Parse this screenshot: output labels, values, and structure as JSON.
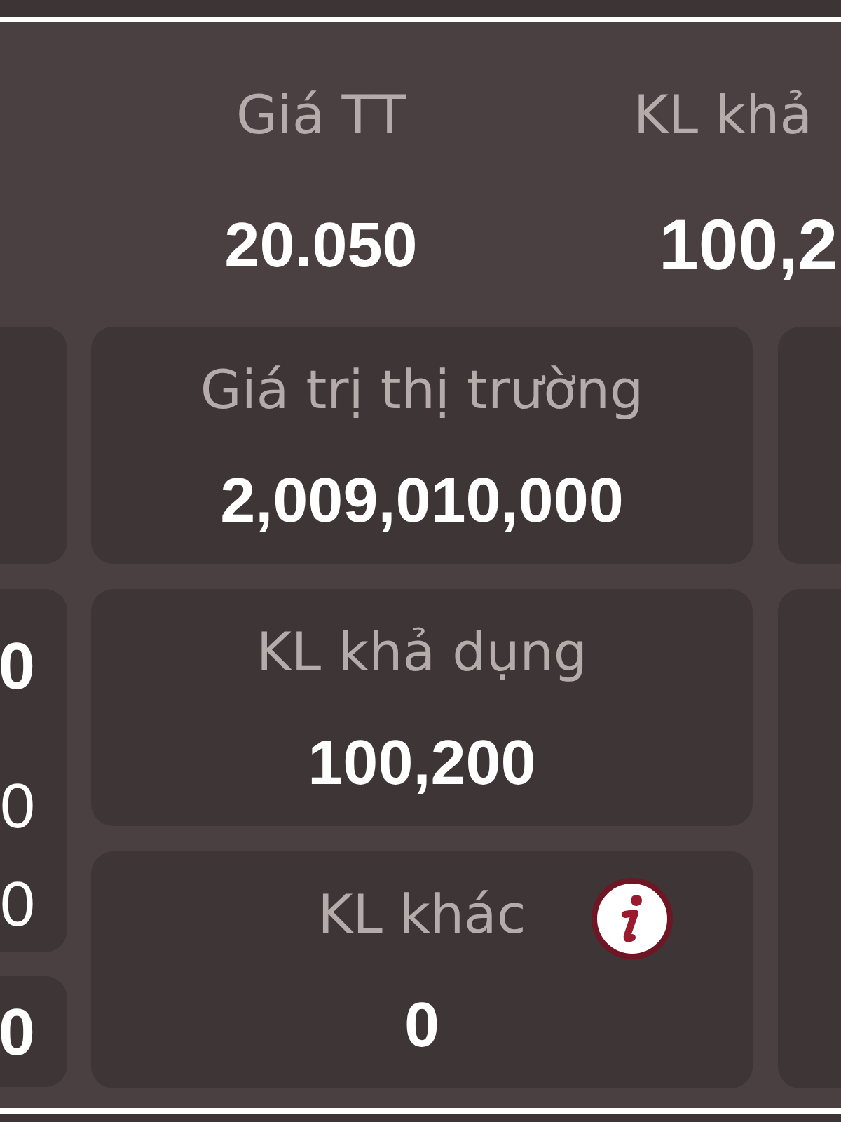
{
  "header": {
    "columns": [
      {
        "label": "Giá TT",
        "value": "20.050"
      },
      {
        "label": "KL khả",
        "value": "100,2"
      }
    ]
  },
  "left_column": [
    {
      "values": [
        {
          "kind": "primary",
          "text": "0"
        },
        {
          "kind": "secondary",
          "text": "0"
        },
        {
          "kind": "secondary",
          "text": "0"
        }
      ]
    },
    {
      "values": [
        {
          "kind": "primary",
          "text": "0"
        }
      ]
    }
  ],
  "center_column": [
    {
      "label": "Giá trị thị trường",
      "value": "2,009,010,000",
      "info": false
    },
    {
      "label": "KL khả dụng",
      "value": "100,200",
      "info": false
    },
    {
      "label": "KL khác",
      "value": "0",
      "info": true
    }
  ]
}
